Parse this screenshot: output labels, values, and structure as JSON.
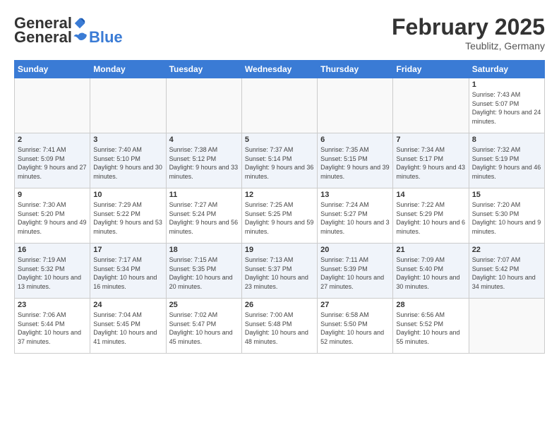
{
  "logo": {
    "general": "General",
    "blue": "Blue"
  },
  "header": {
    "month": "February 2025",
    "location": "Teublitz, Germany"
  },
  "days_of_week": [
    "Sunday",
    "Monday",
    "Tuesday",
    "Wednesday",
    "Thursday",
    "Friday",
    "Saturday"
  ],
  "weeks": [
    [
      {
        "day": "",
        "info": ""
      },
      {
        "day": "",
        "info": ""
      },
      {
        "day": "",
        "info": ""
      },
      {
        "day": "",
        "info": ""
      },
      {
        "day": "",
        "info": ""
      },
      {
        "day": "",
        "info": ""
      },
      {
        "day": "1",
        "info": "Sunrise: 7:43 AM\nSunset: 5:07 PM\nDaylight: 9 hours and 24 minutes."
      }
    ],
    [
      {
        "day": "2",
        "info": "Sunrise: 7:41 AM\nSunset: 5:09 PM\nDaylight: 9 hours and 27 minutes."
      },
      {
        "day": "3",
        "info": "Sunrise: 7:40 AM\nSunset: 5:10 PM\nDaylight: 9 hours and 30 minutes."
      },
      {
        "day": "4",
        "info": "Sunrise: 7:38 AM\nSunset: 5:12 PM\nDaylight: 9 hours and 33 minutes."
      },
      {
        "day": "5",
        "info": "Sunrise: 7:37 AM\nSunset: 5:14 PM\nDaylight: 9 hours and 36 minutes."
      },
      {
        "day": "6",
        "info": "Sunrise: 7:35 AM\nSunset: 5:15 PM\nDaylight: 9 hours and 39 minutes."
      },
      {
        "day": "7",
        "info": "Sunrise: 7:34 AM\nSunset: 5:17 PM\nDaylight: 9 hours and 43 minutes."
      },
      {
        "day": "8",
        "info": "Sunrise: 7:32 AM\nSunset: 5:19 PM\nDaylight: 9 hours and 46 minutes."
      }
    ],
    [
      {
        "day": "9",
        "info": "Sunrise: 7:30 AM\nSunset: 5:20 PM\nDaylight: 9 hours and 49 minutes."
      },
      {
        "day": "10",
        "info": "Sunrise: 7:29 AM\nSunset: 5:22 PM\nDaylight: 9 hours and 53 minutes."
      },
      {
        "day": "11",
        "info": "Sunrise: 7:27 AM\nSunset: 5:24 PM\nDaylight: 9 hours and 56 minutes."
      },
      {
        "day": "12",
        "info": "Sunrise: 7:25 AM\nSunset: 5:25 PM\nDaylight: 9 hours and 59 minutes."
      },
      {
        "day": "13",
        "info": "Sunrise: 7:24 AM\nSunset: 5:27 PM\nDaylight: 10 hours and 3 minutes."
      },
      {
        "day": "14",
        "info": "Sunrise: 7:22 AM\nSunset: 5:29 PM\nDaylight: 10 hours and 6 minutes."
      },
      {
        "day": "15",
        "info": "Sunrise: 7:20 AM\nSunset: 5:30 PM\nDaylight: 10 hours and 9 minutes."
      }
    ],
    [
      {
        "day": "16",
        "info": "Sunrise: 7:19 AM\nSunset: 5:32 PM\nDaylight: 10 hours and 13 minutes."
      },
      {
        "day": "17",
        "info": "Sunrise: 7:17 AM\nSunset: 5:34 PM\nDaylight: 10 hours and 16 minutes."
      },
      {
        "day": "18",
        "info": "Sunrise: 7:15 AM\nSunset: 5:35 PM\nDaylight: 10 hours and 20 minutes."
      },
      {
        "day": "19",
        "info": "Sunrise: 7:13 AM\nSunset: 5:37 PM\nDaylight: 10 hours and 23 minutes."
      },
      {
        "day": "20",
        "info": "Sunrise: 7:11 AM\nSunset: 5:39 PM\nDaylight: 10 hours and 27 minutes."
      },
      {
        "day": "21",
        "info": "Sunrise: 7:09 AM\nSunset: 5:40 PM\nDaylight: 10 hours and 30 minutes."
      },
      {
        "day": "22",
        "info": "Sunrise: 7:07 AM\nSunset: 5:42 PM\nDaylight: 10 hours and 34 minutes."
      }
    ],
    [
      {
        "day": "23",
        "info": "Sunrise: 7:06 AM\nSunset: 5:44 PM\nDaylight: 10 hours and 37 minutes."
      },
      {
        "day": "24",
        "info": "Sunrise: 7:04 AM\nSunset: 5:45 PM\nDaylight: 10 hours and 41 minutes."
      },
      {
        "day": "25",
        "info": "Sunrise: 7:02 AM\nSunset: 5:47 PM\nDaylight: 10 hours and 45 minutes."
      },
      {
        "day": "26",
        "info": "Sunrise: 7:00 AM\nSunset: 5:48 PM\nDaylight: 10 hours and 48 minutes."
      },
      {
        "day": "27",
        "info": "Sunrise: 6:58 AM\nSunset: 5:50 PM\nDaylight: 10 hours and 52 minutes."
      },
      {
        "day": "28",
        "info": "Sunrise: 6:56 AM\nSunset: 5:52 PM\nDaylight: 10 hours and 55 minutes."
      },
      {
        "day": "",
        "info": ""
      }
    ]
  ]
}
